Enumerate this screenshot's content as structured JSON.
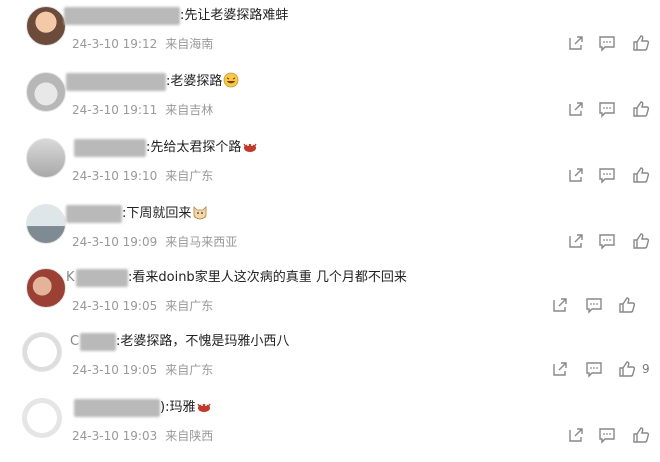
{
  "comments": [
    {
      "prefix": "",
      "text": ":先让老婆探路难蚌",
      "emoji": "",
      "date": "24-3-10 19:12",
      "location": "来自海南",
      "likes": ""
    },
    {
      "prefix": "",
      "text": ":老婆探路",
      "emoji": "laugh-emoji",
      "date": "24-3-10 19:11",
      "location": "来自吉林",
      "likes": ""
    },
    {
      "prefix": "",
      "text": ":先给太君探个路",
      "emoji": "crab-emoji",
      "date": "24-3-10 19:10",
      "location": "来自广东",
      "likes": ""
    },
    {
      "prefix": "",
      "text": ":下周就回来",
      "emoji": "cat-emoji",
      "date": "24-3-10 19:09",
      "location": "来自马来西亚",
      "likes": ""
    },
    {
      "prefix": "K",
      "text": ":看来doinb家里人这次病的真重 几个月都不回来",
      "emoji": "",
      "date": "24-3-10 19:05",
      "location": "来自广东",
      "likes": ""
    },
    {
      "prefix": "C",
      "text": ":老婆探路，不愧是玛雅小西八",
      "emoji": "",
      "date": "24-3-10 19:05",
      "location": "来自广东",
      "likes": "9"
    },
    {
      "prefix": "",
      "text": "):玛雅",
      "emoji": "crab-emoji",
      "date": "24-3-10 19:03",
      "location": "来自陕西",
      "likes": ""
    }
  ],
  "colors": {
    "meta": "#999999",
    "icon": "#888888",
    "redacted": "#b9b9b9",
    "crab": "#c0392b"
  }
}
